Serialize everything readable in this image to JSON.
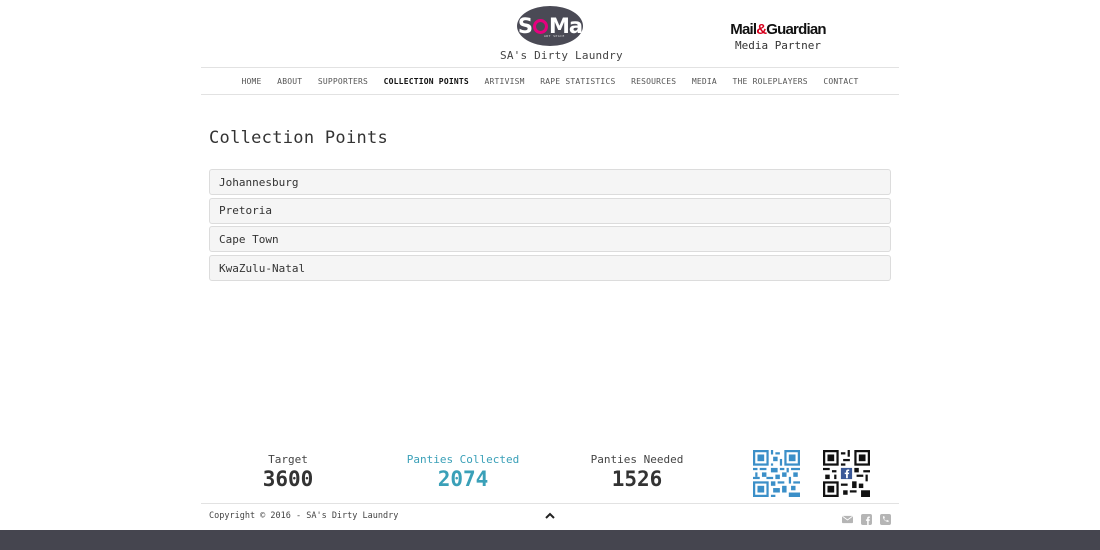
{
  "header": {
    "logo_text": "SoMa",
    "logo_subtext": "ART SPACE",
    "site_name": "SA's Dirty Laundry",
    "partner_logo": "Mail&Guardian",
    "partner_logo_first": "Mail",
    "partner_logo_amp": "&",
    "partner_logo_last": "Guardian",
    "partner_label": "Media Partner"
  },
  "nav": {
    "items": [
      {
        "label": "HOME"
      },
      {
        "label": "ABOUT"
      },
      {
        "label": "SUPPORTERS"
      },
      {
        "label": "COLLECTION POINTS"
      },
      {
        "label": "ARTIVISM"
      },
      {
        "label": "RAPE STATISTICS"
      },
      {
        "label": "RESOURCES"
      },
      {
        "label": "MEDIA"
      },
      {
        "label": "THE ROLEPLAYERS"
      },
      {
        "label": "CONTACT"
      }
    ],
    "active": "COLLECTION POINTS"
  },
  "main": {
    "title": "Collection Points",
    "accordion": [
      {
        "label": "Johannesburg"
      },
      {
        "label": "Pretoria"
      },
      {
        "label": "Cape Town"
      },
      {
        "label": "KwaZulu-Natal"
      }
    ]
  },
  "stats": {
    "target_label": "Target",
    "target_value": "3600",
    "collected_label": "Panties Collected",
    "collected_value": "2074",
    "needed_label": "Panties Needed",
    "needed_value": "1526"
  },
  "qr_codes": [
    {
      "icon": "qr-code-blue-icon",
      "color": "#3b8fc8"
    },
    {
      "icon": "qr-code-facebook-icon",
      "color": "#111111"
    }
  ],
  "footer": {
    "copyright": "Copyright © 2016 - SA's Dirty Laundry",
    "icons": [
      "envelope-icon",
      "facebook-icon",
      "phone-icon"
    ]
  },
  "colors": {
    "accent": "#3aa0b8",
    "logo_pink": "#e6007e",
    "bottom_bar": "#45454f"
  }
}
